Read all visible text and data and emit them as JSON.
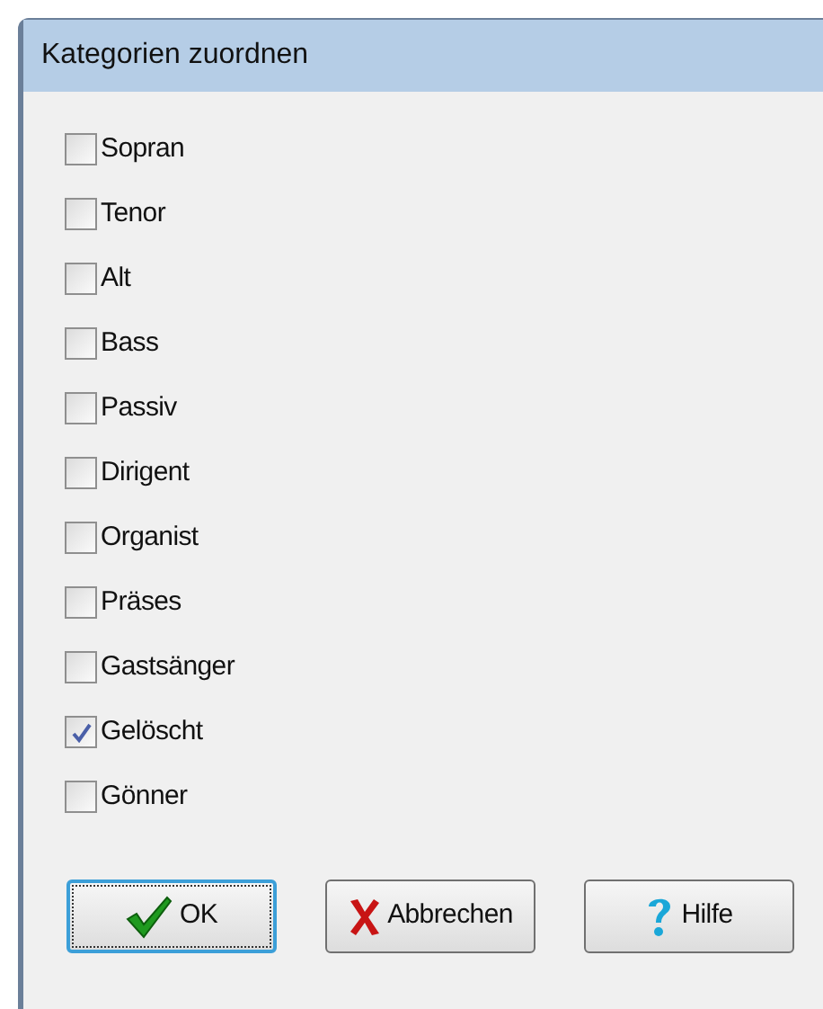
{
  "window": {
    "title": "Kategorien zuordnen"
  },
  "categories": [
    {
      "label": "Sopran",
      "checked": false
    },
    {
      "label": "Tenor",
      "checked": false
    },
    {
      "label": "Alt",
      "checked": false
    },
    {
      "label": "Bass",
      "checked": false
    },
    {
      "label": "Passiv",
      "checked": false
    },
    {
      "label": "Dirigent",
      "checked": false
    },
    {
      "label": "Organist",
      "checked": false
    },
    {
      "label": "Präses",
      "checked": false
    },
    {
      "label": "Gastsänger",
      "checked": false
    },
    {
      "label": "Gelöscht",
      "checked": true
    },
    {
      "label": "Gönner",
      "checked": false
    }
  ],
  "buttons": [
    {
      "label": "OK",
      "kind": "ok",
      "focused": true
    },
    {
      "label": "Abbrechen",
      "kind": "cancel",
      "focused": false
    },
    {
      "label": "Hilfe",
      "kind": "help",
      "focused": false
    }
  ]
}
